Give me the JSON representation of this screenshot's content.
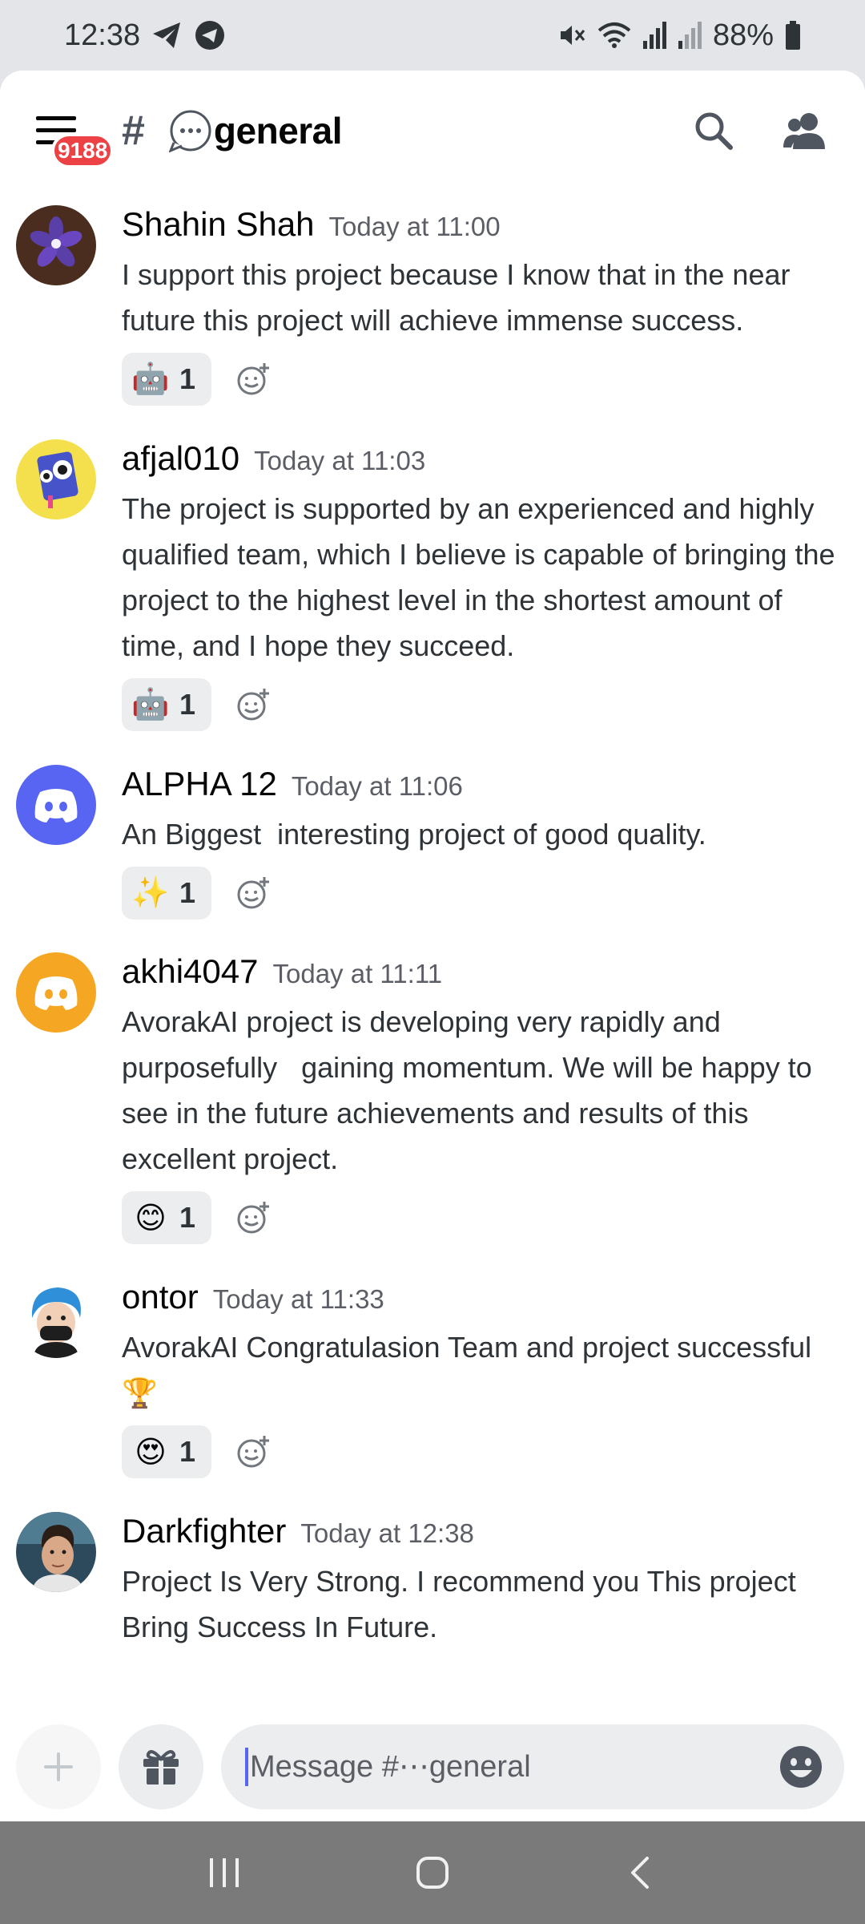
{
  "status": {
    "time": "12:38",
    "battery": "88%"
  },
  "header": {
    "unread_badge": "9188",
    "channel_prefix": "#",
    "channel_name": "general"
  },
  "messages": [
    {
      "username": "Shahin Shah",
      "timestamp": "Today at 11:00",
      "text": "I support this project because I know that in the near future this project will achieve immense success.",
      "reaction": {
        "emoji": "robot-face",
        "glyph": "🤖",
        "count": "1"
      }
    },
    {
      "username": "afjal010",
      "timestamp": "Today at 11:03",
      "text": "The project is supported by an experienced and highly qualified team, which I believe is capable of bringing the project to the highest level in the shortest amount of time, and I hope they succeed.",
      "reaction": {
        "emoji": "robot-face",
        "glyph": "🤖",
        "count": "1"
      }
    },
    {
      "username": "ALPHA 12",
      "timestamp": "Today at 11:06",
      "text": "An Biggest  interesting project of good quality.",
      "reaction": {
        "emoji": "sparkles",
        "glyph": "✨",
        "count": "1"
      }
    },
    {
      "username": "akhi4047",
      "timestamp": "Today at 11:11",
      "text": "AvorakAI project is developing very rapidly and purposefully   gaining momentum. We will be happy to see in the future achievements and results of this excellent project.",
      "reaction": {
        "emoji": "smiling-face",
        "glyph": "😊",
        "count": "1"
      }
    },
    {
      "username": "ontor",
      "timestamp": "Today at 11:33",
      "text": "AvorakAI Congratulasion Team and project successful 🏆",
      "reaction": {
        "emoji": "heart-eyes",
        "glyph": "😍",
        "count": "1"
      }
    },
    {
      "username": "Darkfighter",
      "timestamp": "Today at 12:38",
      "text": "Project Is Very Strong. I recommend you This project Bring Success In Future.",
      "reaction": null
    }
  ],
  "composer": {
    "placeholder": "Message #⋯general"
  },
  "colors": {
    "accent": "#5865f2",
    "badge": "#ed4245",
    "blurple_avatar": "#5865f2",
    "orange_avatar": "#f5a623"
  }
}
